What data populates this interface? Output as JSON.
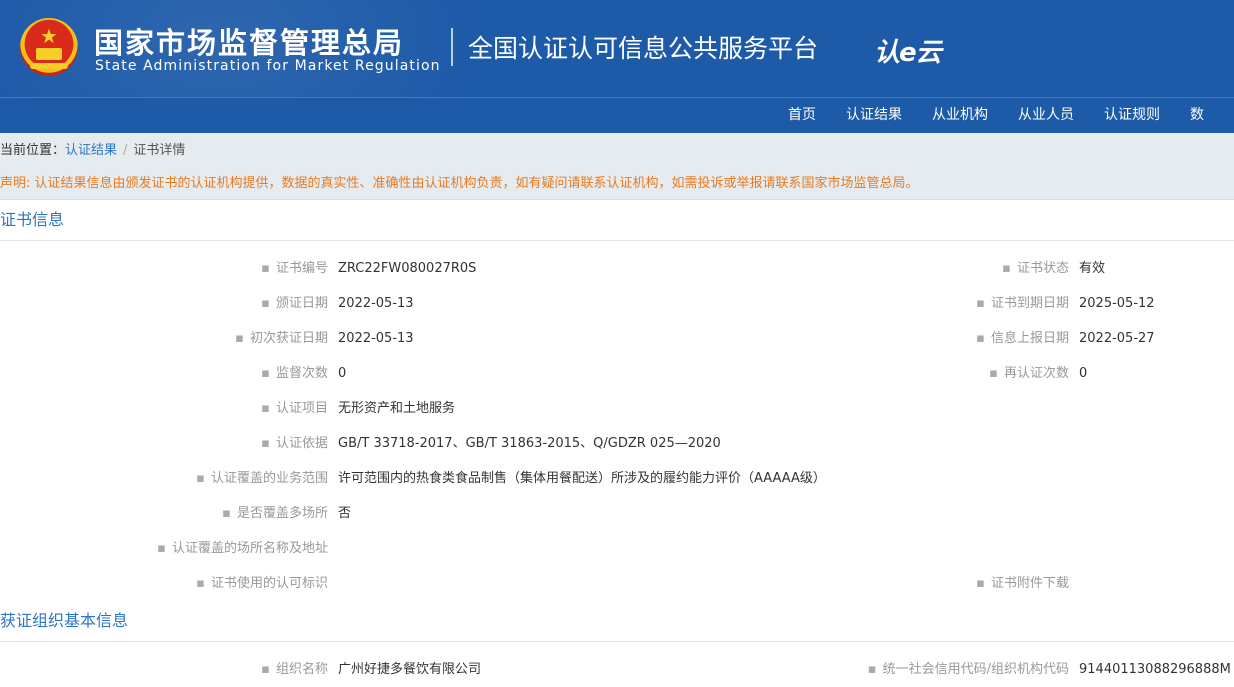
{
  "header": {
    "org_cn": "国家市场监督管理总局",
    "org_en": "State Administration for Market Regulation",
    "platform": "全国认证认可信息公共服务平台",
    "brand": "认e云"
  },
  "nav": [
    "首页",
    "认证结果",
    "从业机构",
    "从业人员",
    "认证规则",
    "数"
  ],
  "breadcrumb": {
    "prefix": "当前位置：",
    "link": "认证结果",
    "sep": "/",
    "current": "证书详情"
  },
  "notice": "声明: 认证结果信息由颁发证书的认证机构提供，数据的真实性、准确性由认证机构负责，如有疑问请联系认证机构，如需投诉或举报请联系国家市场监管总局。",
  "cert_section": {
    "title": "证书信息",
    "fields": {
      "cert_no": {
        "label": "证书编号",
        "value": "ZRC22FW080027R0S"
      },
      "status": {
        "label": "证书状态",
        "value": "有效"
      },
      "issue_date": {
        "label": "颁证日期",
        "value": "2022-05-13"
      },
      "expiry_date": {
        "label": "证书到期日期",
        "value": "2025-05-12"
      },
      "first_date": {
        "label": "初次获证日期",
        "value": "2022-05-13"
      },
      "report_date": {
        "label": "信息上报日期",
        "value": "2022-05-27"
      },
      "supervision": {
        "label": "监督次数",
        "value": "0"
      },
      "recert": {
        "label": "再认证次数",
        "value": "0"
      },
      "project": {
        "label": "认证项目",
        "value": "无形资产和土地服务"
      },
      "basis": {
        "label": "认证依据",
        "value": "GB/T 33718-2017、GB/T 31863-2015、Q/GDZR 025—2020"
      },
      "scope": {
        "label": "认证覆盖的业务范围",
        "value": "许可范围内的热食类食品制售（集体用餐配送）所涉及的履约能力评价（AAAAA级）"
      },
      "multi_site": {
        "label": "是否覆盖多场所",
        "value": "否"
      },
      "sites": {
        "label": "认证覆盖的场所名称及地址",
        "value": ""
      },
      "marks": {
        "label": "证书使用的认可标识",
        "value": ""
      },
      "attachment": {
        "label": "证书附件下载",
        "value": ""
      }
    }
  },
  "org_section": {
    "title": "获证组织基本信息",
    "fields": {
      "name": {
        "label": "组织名称",
        "value": "广州好捷多餐饮有限公司"
      },
      "credit_code": {
        "label": "统一社会信用代码/组织机构代码",
        "value": "91440113088296888M"
      }
    }
  }
}
